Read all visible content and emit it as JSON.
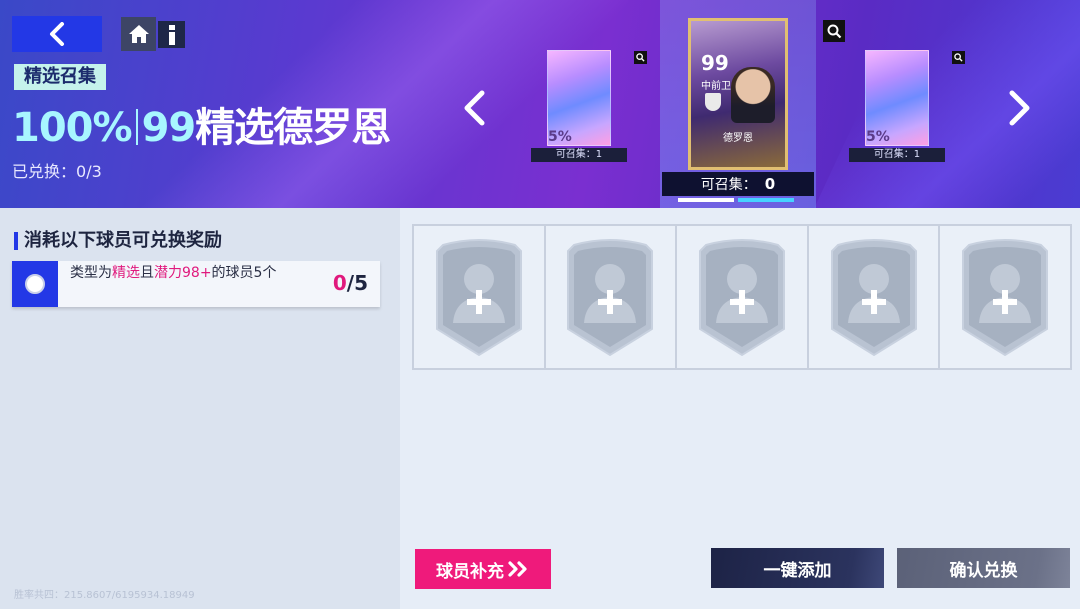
{
  "header": {
    "tag": "精选召集",
    "title_percent": "100%",
    "title_rating": "99",
    "title_name": "精选德罗恩",
    "redeemed_label": "已兑换：",
    "redeemed_value": "0/3"
  },
  "carousel": {
    "side_pack_label": "5%",
    "side_pack_count": "可召集：1",
    "center_card": {
      "rating": "99",
      "position": "中前卫",
      "player_name": "德罗恩"
    },
    "center_count_label": "可召集：",
    "center_count_value": "0",
    "active_page": 1,
    "page_count": 2
  },
  "requirements": {
    "title": "消耗以下球员可兑换奖励",
    "items": [
      {
        "text_prefix": "类型为",
        "highlight1": "精选",
        "text_mid": "且",
        "highlight2": "潜力98+",
        "text_suffix": "的球员5个",
        "progress_current": "0",
        "progress_total": "/5"
      }
    ]
  },
  "slots": {
    "count": 5
  },
  "buttons": {
    "supply": "球员补充",
    "add_all": "一键添加",
    "confirm": "确认兑换"
  },
  "colors": {
    "accent_blue": "#2338e6",
    "accent_pink": "#e0197d",
    "highlight_cyan": "#a8f6ff"
  },
  "watermark": "胜率共四：215.8607/6195934.18949"
}
